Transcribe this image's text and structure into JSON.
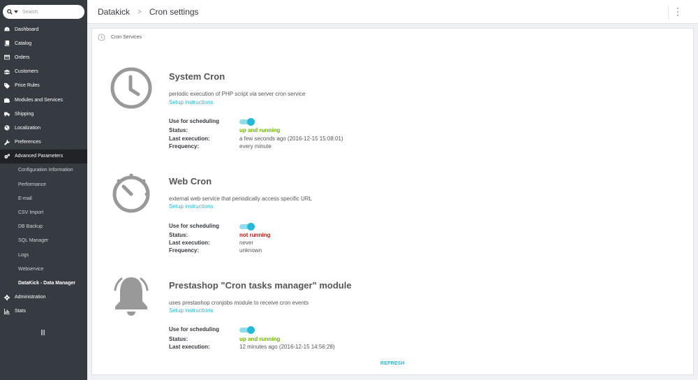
{
  "search": {
    "placeholder": "Search"
  },
  "sidebar": {
    "items": [
      {
        "label": "Dashboard",
        "icon": "dashboard-icon"
      },
      {
        "label": "Catalog",
        "icon": "catalog-icon"
      },
      {
        "label": "Orders",
        "icon": "orders-icon"
      },
      {
        "label": "Customers",
        "icon": "customers-icon"
      },
      {
        "label": "Price Rules",
        "icon": "tag-icon"
      },
      {
        "label": "Modules and Services",
        "icon": "puzzle-icon"
      },
      {
        "label": "Shipping",
        "icon": "truck-icon"
      },
      {
        "label": "Localization",
        "icon": "globe-icon"
      },
      {
        "label": "Preferences",
        "icon": "wrench-icon"
      },
      {
        "label": "Advanced Parameters",
        "icon": "gears-icon"
      }
    ],
    "subitems": [
      "Configuration Information",
      "Performance",
      "E-mail",
      "CSV Import",
      "DB Backup",
      "SQL Manager",
      "Logs",
      "Webservice",
      "DataKick - Data Manager"
    ],
    "bottom_items": [
      {
        "label": "Administration",
        "icon": "gear-icon"
      },
      {
        "label": "Stats",
        "icon": "bar-chart-icon"
      }
    ]
  },
  "header": {
    "breadcrumb_root": "Datakick",
    "separator": ">",
    "breadcrumb_current": "Cron settings"
  },
  "panel": {
    "title": "Cron Services",
    "services": [
      {
        "title": "System Cron",
        "icon": "clock-icon",
        "description": "periodic execution of PHP script via server cron service",
        "link": "Setup instructions",
        "use_label": "Use for scheduling",
        "use_enabled": true,
        "status_label": "Status:",
        "status": "up and running",
        "last_label": "Last execution:",
        "last": "a few seconds ago (2016-12-15 15:08:01)",
        "freq_label": "Frequency:",
        "freq": "every minute"
      },
      {
        "title": "Web Cron",
        "icon": "timer-icon",
        "description": "external web service that periodically access specific URL",
        "link": "Setup instructions",
        "use_label": "Use for scheduling",
        "use_enabled": true,
        "status_label": "Status:",
        "status": "not running",
        "last_label": "Last execution:",
        "last": "never",
        "freq_label": "Frequency:",
        "freq": "unknown"
      },
      {
        "title": "Prestashop \"Cron tasks manager\" module",
        "icon": "bell-icon",
        "description": "uses prestashop cronjobs module to receive cron events",
        "link": "Setup instructions",
        "use_label": "Use for scheduling",
        "use_enabled": true,
        "status_label": "Status:",
        "status": "up and running",
        "last_label": "Last execution:",
        "last": "12 minutes ago (2016-12-15 14:56:28)"
      }
    ],
    "refresh_label": "REFRESH"
  },
  "colors": {
    "accent": "#25b9d7",
    "status_ok": "#70b500",
    "status_bad": "#c4170d",
    "sidebar_bg": "#363a41"
  }
}
